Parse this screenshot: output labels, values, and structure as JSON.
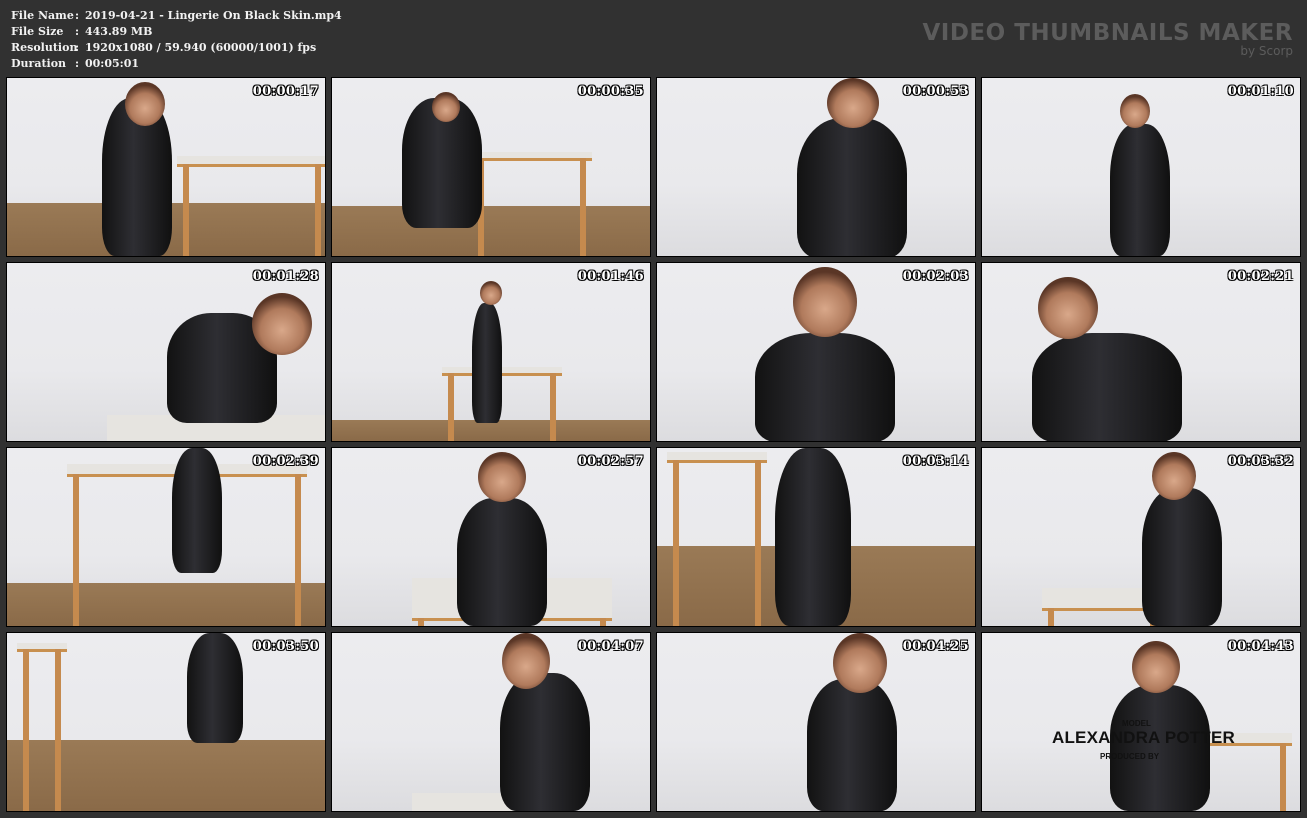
{
  "info": {
    "file_name_label": "File Name",
    "file_name": "2019-04-21 - Lingerie On Black Skin.mp4",
    "file_size_label": "File Size",
    "file_size": "443.89 MB",
    "resolution_label": "Resolution",
    "resolution": "1920x1080 / 59.940 (60000/1001) fps",
    "duration_label": "Duration",
    "duration": "00:05:01",
    "separator": ":"
  },
  "brand": {
    "title": "VIDEO THUMBNAILS MAKER",
    "subtitle": "by Scorp"
  },
  "thumbnails": [
    {
      "timestamp": "00:00:17"
    },
    {
      "timestamp": "00:00:35"
    },
    {
      "timestamp": "00:00:53"
    },
    {
      "timestamp": "00:01:10"
    },
    {
      "timestamp": "00:01:28"
    },
    {
      "timestamp": "00:01:46"
    },
    {
      "timestamp": "00:02:03"
    },
    {
      "timestamp": "00:02:21"
    },
    {
      "timestamp": "00:02:39"
    },
    {
      "timestamp": "00:02:57"
    },
    {
      "timestamp": "00:03:14"
    },
    {
      "timestamp": "00:03:32"
    },
    {
      "timestamp": "00:03:50"
    },
    {
      "timestamp": "00:04:07"
    },
    {
      "timestamp": "00:04:25"
    },
    {
      "timestamp": "00:04:43"
    }
  ],
  "credit": {
    "model_label": "MODEL",
    "model_name": "ALEXANDRA POTTER",
    "produced_label": "PRODUCED BY"
  },
  "colors": {
    "background": "#313131",
    "brand_text": "#5c5c5c",
    "wall": "#e9e9ec",
    "floor": "#8a6a48"
  }
}
